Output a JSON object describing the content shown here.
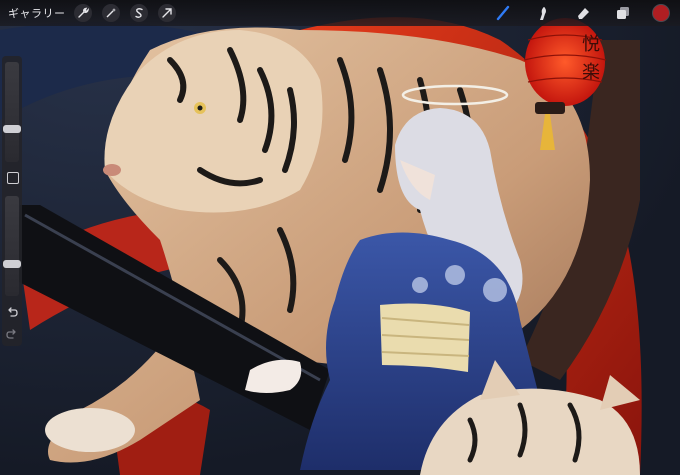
{
  "toolbar": {
    "gallery_label": "ギャラリー",
    "left_tools": [
      "wrench-icon",
      "magic-wand-icon",
      "selection-s-icon",
      "transform-arrow-icon"
    ],
    "right_tools": [
      "brush-icon",
      "smudge-icon",
      "eraser-icon",
      "layers-icon"
    ],
    "active_tool": "brush-icon",
    "current_color": "#b01e22",
    "accent": "#2f7bf5"
  },
  "sidebar": {
    "size_level": 0.32,
    "opacity_level": 0.3,
    "controls": [
      "modify-square-icon",
      "undo-icon",
      "redo-icon"
    ]
  },
  "artwork": {
    "lantern_text": [
      "悦",
      "楽"
    ],
    "subjects": [
      "tiger",
      "girl-in-kimono",
      "red-lantern",
      "tiger-cub"
    ]
  }
}
